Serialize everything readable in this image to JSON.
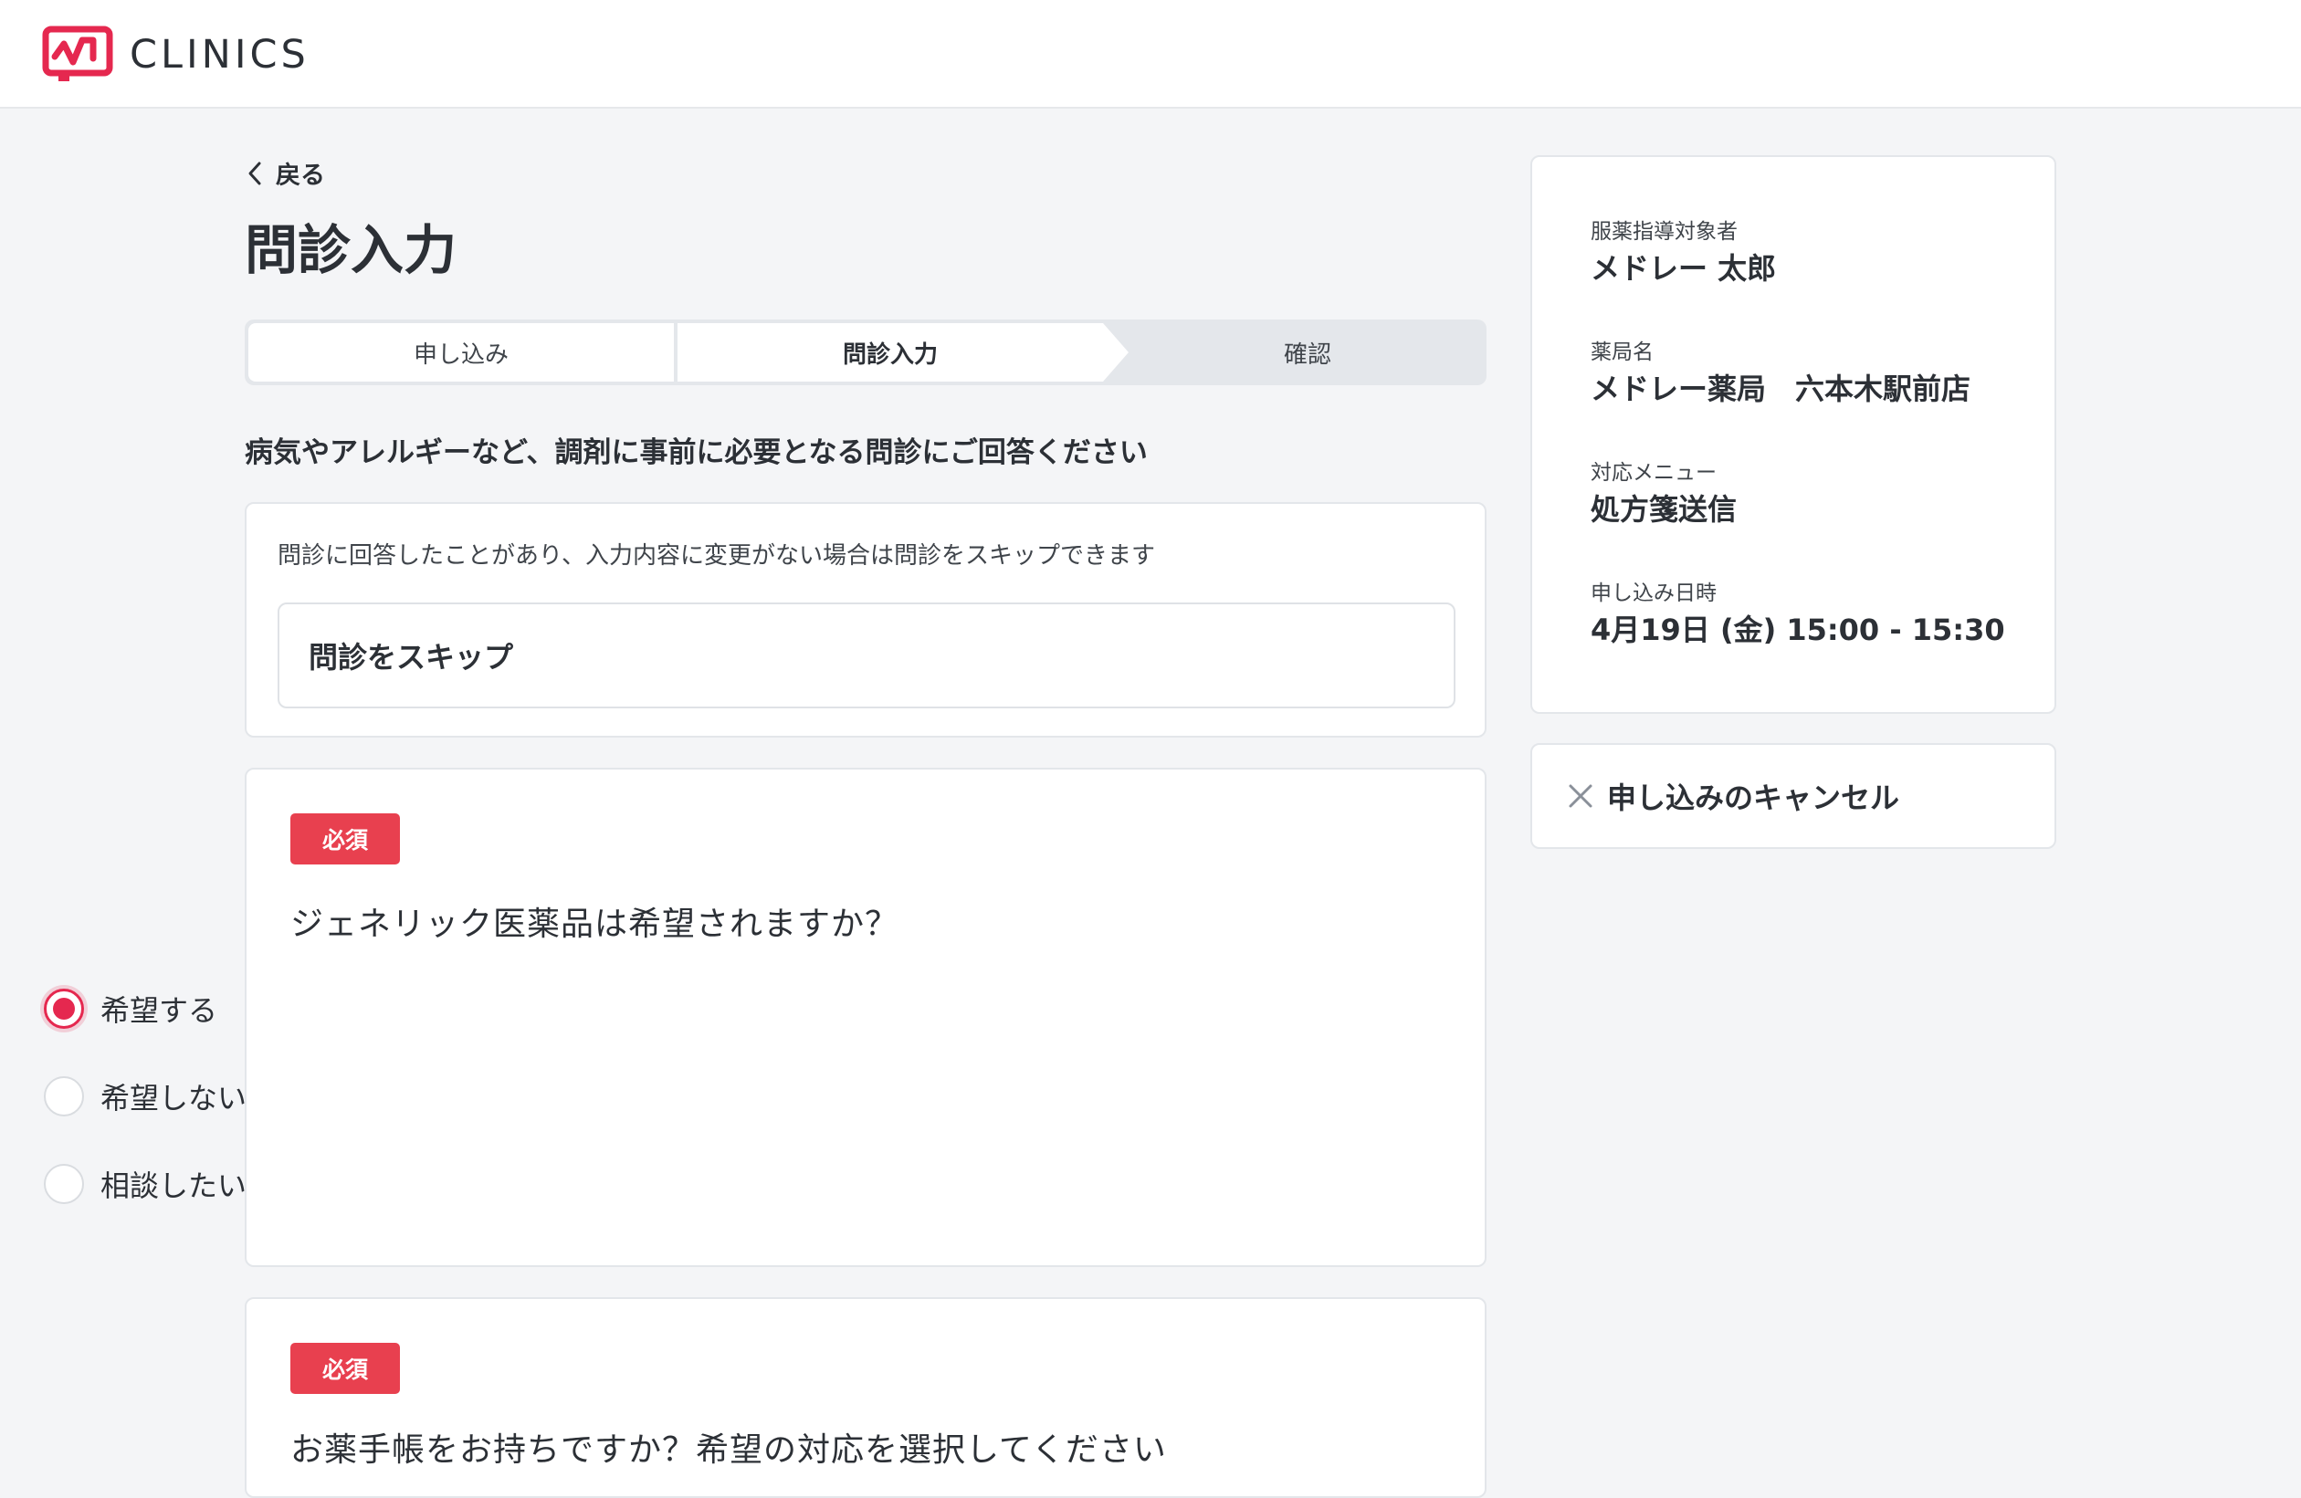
{
  "header": {
    "logo_text": "CLINICS",
    "brand_color": "#e5284f"
  },
  "nav": {
    "back_label": "戻る"
  },
  "page_title": "問診入力",
  "stepper": {
    "steps": [
      {
        "label": "申し込み",
        "state": "done"
      },
      {
        "label": "問診入力",
        "state": "current"
      },
      {
        "label": "確認",
        "state": "upcoming"
      }
    ]
  },
  "lead_text": "病気やアレルギーなど、調剤に事前に必要となる問診にご回答ください",
  "skip": {
    "note": "問診に回答したことがあり、入力内容に変更がない場合は問診をスキップできます",
    "button_label": "問診をスキップ"
  },
  "questions": [
    {
      "badge": "必須",
      "text": "ジェネリック医薬品は希望されますか？",
      "options": [
        {
          "label": "希望する",
          "selected": true
        },
        {
          "label": "希望しない",
          "selected": false
        },
        {
          "label": "相談したい",
          "selected": false
        }
      ]
    },
    {
      "badge": "必須",
      "text": "お薬手帳をお持ちですか？希望の対応を選択してください"
    }
  ],
  "sidebar": {
    "items": [
      {
        "label": "服薬指導対象者",
        "value": "メドレー 太郎"
      },
      {
        "label": "薬局名",
        "value": "メドレー薬局　六本木駅前店"
      },
      {
        "label": "対応メニュー",
        "value": "処方箋送信"
      },
      {
        "label": "申し込み日時",
        "value": "4月19日 (金) 15:00 - 15:30"
      }
    ],
    "cancel_label": "申し込みのキャンセル"
  },
  "colors": {
    "badge": "#e8404f",
    "radio_selected": "#e5284f",
    "background": "#f4f5f7"
  }
}
